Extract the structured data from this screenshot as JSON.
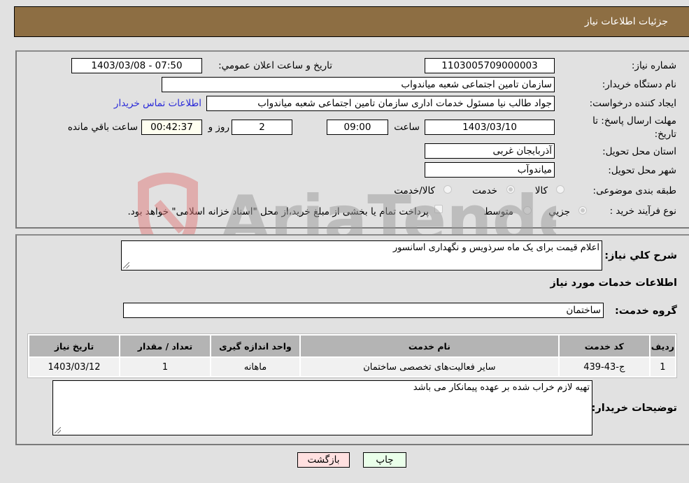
{
  "header": {
    "title": "جزئیات اطلاعات نیاز"
  },
  "form": {
    "need_number": {
      "label": "شماره نیاز:",
      "value": "1103005709000003"
    },
    "announce_datetime": {
      "label": "تاریخ و ساعت اعلان عمومي:",
      "value": "1403/03/08 - 07:50"
    },
    "buyer_org": {
      "label": "نام دستگاه خریدار:",
      "value": "سازمان تامین اجتماعی شعبه میاندواب"
    },
    "requester": {
      "label": "ایجاد کننده درخواست:",
      "value": "جواد طالب نیا مسئول خدمات اداری سازمان تامین اجتماعی شعبه میاندواب"
    },
    "buyer_contact_link": "اطلاعات تماس خریدار",
    "deadline": {
      "label": "مهلت ارسال پاسخ: تا تاریخ:",
      "date": "1403/03/10",
      "time_label": "ساعت",
      "time": "09:00",
      "days": "2",
      "days_label": "روز و",
      "remaining": "00:42:37",
      "remaining_label": "ساعت باقي مانده"
    },
    "province": {
      "label": "استان محل تحویل:",
      "value": "آذربایجان غربی"
    },
    "city": {
      "label": "شهر محل تحویل:",
      "value": "میاندوآب"
    },
    "category": {
      "label": "طبقه بندی موضوعی:",
      "options": [
        "کالا",
        "خدمت",
        "کالا/خدمت"
      ],
      "selected": "خدمت"
    },
    "purchase_type": {
      "label": "نوع فرآیند خرید :",
      "options": [
        "جزيي",
        "متوسط"
      ],
      "selected": "جزيي",
      "treasury_note": "پرداخت تمام یا بخشی از مبلغ خرید،از محل \"اسناد خزانه اسلامی\" خواهد بود.",
      "treasury_checked": false
    }
  },
  "details": {
    "summary_label": "شرح کلي نياز:",
    "summary_value": "اعلام قیمت برای یک ماه سرذویس و نگهداری اسانسور",
    "services_heading": "اطلاعات خدمات مورد نیاز",
    "service_group_label": "گروه خدمت:",
    "service_group_value": "ساختمان",
    "table": {
      "headers": [
        "ردیف",
        "کد خدمت",
        "نام خدمت",
        "واحد اندازه گیری",
        "تعداد / مقدار",
        "تاریخ نیاز"
      ],
      "rows": [
        [
          "1",
          "ج-43-439",
          "سایر فعالیت‌های تخصصی ساختمان",
          "ماهانه",
          "1",
          "1403/03/12"
        ]
      ]
    },
    "buyer_notes_label": "توضیحات خریدار:",
    "buyer_notes_value": "تهیه لازم خراب شده بر عهده پیمانکار می باشد"
  },
  "buttons": {
    "print": "چاپ",
    "back": "بازگشت"
  },
  "colors": {
    "header_bg": "#8d6e43",
    "print_bg": "#eaffea",
    "back_bg": "#ffe0e0",
    "link": "#2a2ad8"
  },
  "watermark": "AriaTender.neT"
}
